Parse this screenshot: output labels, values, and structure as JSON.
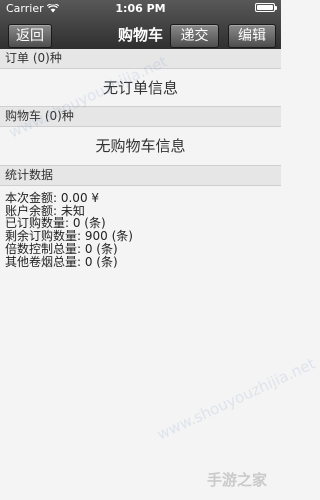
{
  "status_bar": {
    "carrier": "Carrier",
    "wifi_icon": "wifi-icon",
    "time": "1:06 PM",
    "battery_icon": "battery-icon"
  },
  "nav": {
    "back_label": "返回",
    "title": "购物车",
    "submit_label": "递交",
    "edit_label": "编辑"
  },
  "orders": {
    "header": "订单 (0)种",
    "empty_text": "无订单信息"
  },
  "cart": {
    "header": "购物车 (0)种",
    "empty_text": "无购物车信息"
  },
  "stats": {
    "header": "统计数据",
    "rows": [
      "本次金额: 0.00 ¥",
      "账户余额: 未知",
      "已订购数量: 0 (条)",
      "剩余订购数量: 900 (条)",
      "倍数控制总量: 0 (条)",
      "其他卷烟总量: 0 (条)"
    ]
  },
  "watermark": {
    "text": "www.shouyouzhijia.net",
    "logo": "手游之家"
  }
}
